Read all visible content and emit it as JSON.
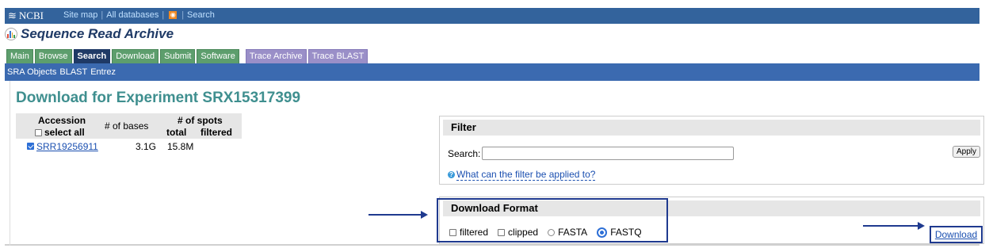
{
  "topbar": {
    "logo": "NCBI",
    "links": [
      "Site map",
      "All databases",
      "Search"
    ]
  },
  "app_title": "Sequence Read Archive",
  "tabs": [
    {
      "label": "Main"
    },
    {
      "label": "Browse"
    },
    {
      "label": "Search",
      "active": true
    },
    {
      "label": "Download"
    },
    {
      "label": "Submit"
    },
    {
      "label": "Software"
    },
    {
      "label": "Trace Archive"
    },
    {
      "label": "Trace BLAST"
    }
  ],
  "subnav": [
    "SRA Objects",
    "BLAST",
    "Entrez"
  ],
  "page_title": "Download for Experiment SRX15317399",
  "table": {
    "col_accession": "Accession",
    "select_all": "select all",
    "col_bases": "# of bases",
    "col_spots": "# of spots",
    "col_total": "total",
    "col_filtered": "filtered",
    "rows": [
      {
        "accession": "SRR19256911",
        "checked": true,
        "bases": "3.1G",
        "spots_total": "15.8M",
        "spots_filtered": ""
      }
    ]
  },
  "filter": {
    "header": "Filter",
    "search_label": "Search:",
    "search_value": "",
    "apply_label": "Apply",
    "help_text": "What can the filter be applied to?"
  },
  "download_format": {
    "header": "Download Format",
    "options": [
      {
        "label": "filtered",
        "kind": "checkbox",
        "checked": false
      },
      {
        "label": "clipped",
        "kind": "checkbox",
        "checked": false
      },
      {
        "label": "FASTA",
        "kind": "radio",
        "checked": false
      },
      {
        "label": "FASTQ",
        "kind": "radio",
        "checked": true
      }
    ],
    "download_label": "Download"
  },
  "colors": {
    "topbar": "#33639c",
    "subbar": "#3b6ab0",
    "title": "#3f8f8f",
    "annotation": "#1f3a8f"
  }
}
